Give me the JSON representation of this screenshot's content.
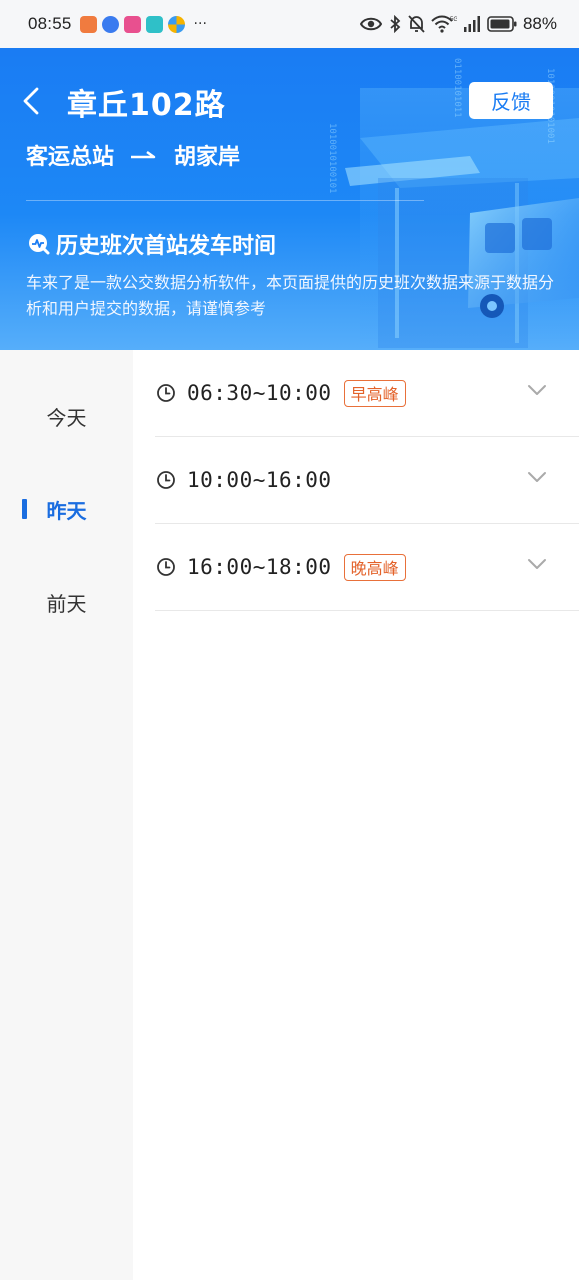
{
  "status_bar": {
    "time": "08:55",
    "battery_percent": "88%",
    "more_glyph": "···",
    "network": "5G",
    "icons": [
      "eye-icon",
      "bluetooth-icon",
      "mute-icon",
      "wifi-icon",
      "signal-icon",
      "battery-icon"
    ]
  },
  "header": {
    "route_name": "章丘102路",
    "feedback_label": "反馈",
    "origin": "客运总站",
    "destination": "胡家岸",
    "history_title": "历史班次首站发车时间",
    "history_description": "车来了是一款公交数据分析软件，本页面提供的历史班次数据来源于数据分析和用户提交的数据，请谨慎参考"
  },
  "colors": {
    "header_blue": "#1a7cf3",
    "active_blue": "#1a6de0",
    "peak_orange": "#e3622a",
    "sidebar_bg": "#f7f7f7"
  },
  "days": [
    {
      "label": "今天",
      "active": false
    },
    {
      "label": "昨天",
      "active": true
    },
    {
      "label": "前天",
      "active": false
    }
  ],
  "time_slots": [
    {
      "range": "06:30~10:00",
      "badge": "早高峰"
    },
    {
      "range": "10:00~16:00",
      "badge": ""
    },
    {
      "range": "16:00~18:00",
      "badge": "晚高峰"
    }
  ]
}
